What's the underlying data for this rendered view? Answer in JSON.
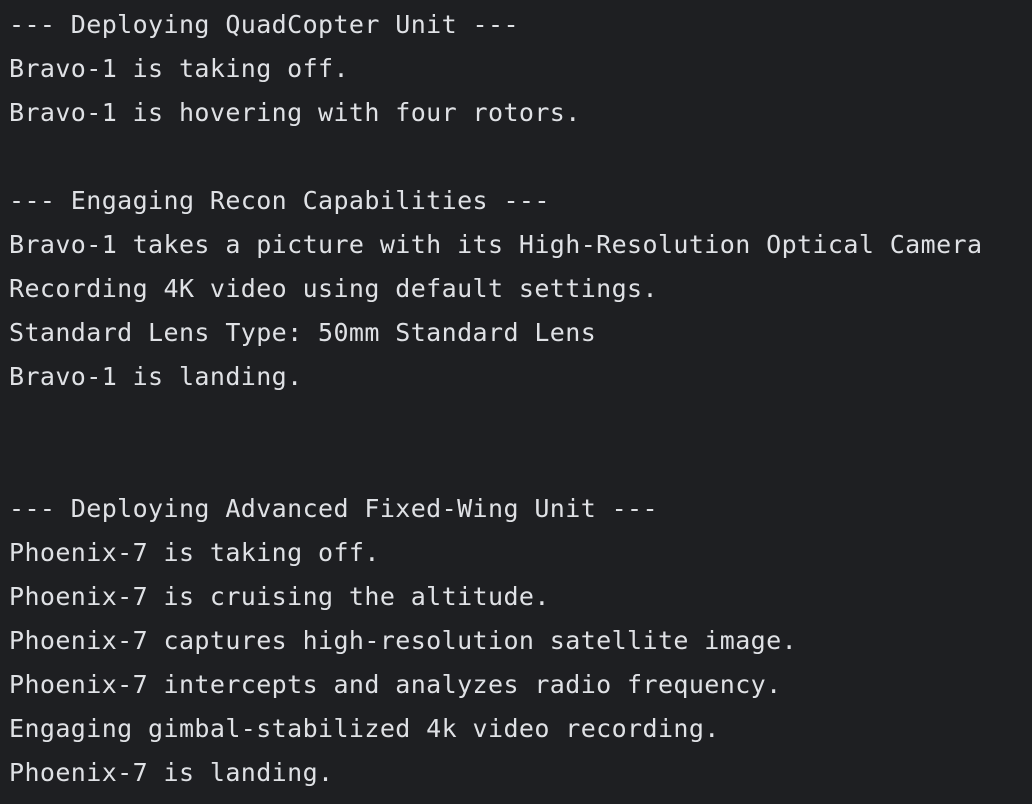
{
  "console": {
    "lines": [
      "--- Deploying QuadCopter Unit ---",
      "Bravo-1 is taking off.",
      "Bravo-1 is hovering with four rotors.",
      "",
      "--- Engaging Recon Capabilities ---",
      "Bravo-1 takes a picture with its High-Resolution Optical Camera",
      "Recording 4K video using default settings.",
      "Standard Lens Type: 50mm Standard Lens",
      "Bravo-1 is landing.",
      "",
      "",
      "--- Deploying Advanced Fixed-Wing Unit ---",
      "Phoenix-7 is taking off.",
      "Phoenix-7 is cruising the altitude.",
      "Phoenix-7 captures high-resolution satellite image.",
      "Phoenix-7 intercepts and analyzes radio frequency.",
      "Engaging gimbal-stabilized 4k video recording.",
      "Phoenix-7 is landing."
    ]
  }
}
